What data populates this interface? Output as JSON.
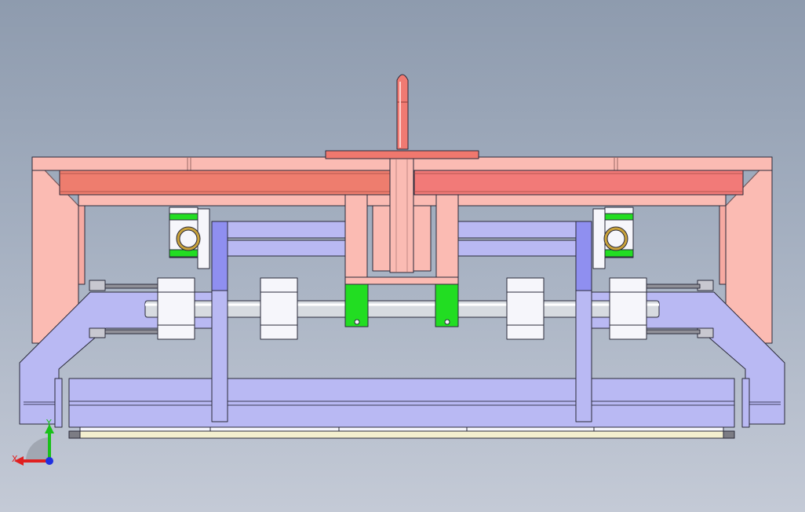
{
  "viewport": {
    "background_top": "#8e9bae",
    "background_bottom": "#c4cad6"
  },
  "model": {
    "parts": [
      "frame-arm",
      "top-beam",
      "lifting-handle",
      "center-bracket",
      "pillow-block-bearing",
      "guide-rail",
      "vertical-plate",
      "linear-bearing",
      "guide-shaft",
      "clamp-block",
      "side-arm",
      "bottom-plate",
      "base-strip"
    ],
    "colors": {
      "frame_pink": "#fbbbb3",
      "beam_red": "#ef7b6c",
      "handle_red": "#f07a72",
      "body_blue": "#b9b9f3",
      "plate_blue": "#8f8ff0",
      "bracket_green": "#22dd22",
      "bearing_gold": "#c9a23a",
      "shaft_gray": "#d7dbe0",
      "block_white": "#f6f6fb",
      "base_cream": "#f3efcf",
      "edge": "#1f1f2e"
    }
  },
  "triad": {
    "x_label": "X",
    "y_label": "Y",
    "x_color": "#e02020",
    "y_color": "#19c019",
    "z_color": "#2030e0"
  }
}
